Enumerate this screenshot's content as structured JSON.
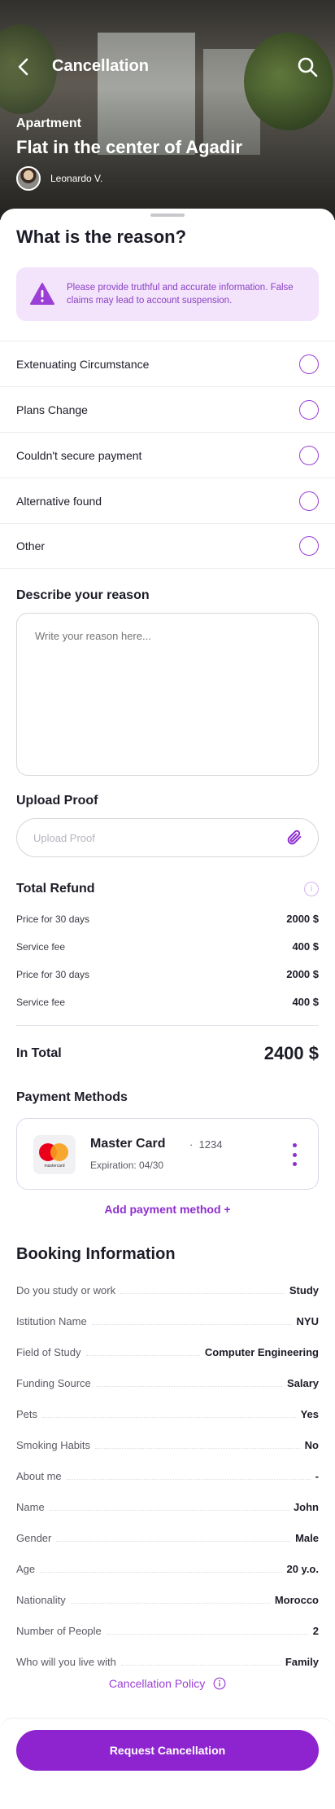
{
  "header": {
    "title": "Cancellation",
    "back_icon": "chevron-left-icon",
    "search_icon": "search-icon"
  },
  "listing": {
    "type": "Apartment",
    "title": "Flat in the center of Agadir",
    "host_name": "Leonardo V."
  },
  "reason": {
    "heading": "What is the reason?",
    "alert_text": "Please provide truthful and accurate information. False claims may lead to account suspension.",
    "options": [
      {
        "label": "Extenuating Circumstance"
      },
      {
        "label": "Plans Change"
      },
      {
        "label": "Couldn't secure payment"
      },
      {
        "label": "Alternative found"
      },
      {
        "label": "Other"
      }
    ]
  },
  "describe": {
    "heading": "Describe your reason",
    "placeholder": "Write your reason here..."
  },
  "upload": {
    "heading": "Upload Proof",
    "placeholder": "Upload Proof"
  },
  "refund": {
    "heading": "Total Refund",
    "rows": [
      {
        "label": "Price for 30 days",
        "value": "2000 $"
      },
      {
        "label": "Service fee",
        "value": "400 $"
      },
      {
        "label": "Price for 30 days",
        "value": "2000 $"
      },
      {
        "label": "Service fee",
        "value": "400 $"
      }
    ],
    "total_label": "In Total",
    "total_value": "2400 $"
  },
  "payment": {
    "heading": "Payment Methods",
    "card": {
      "name": "Master Card",
      "separator": "·",
      "number": "1234",
      "expiration": "Expiration: 04/30",
      "logo_text": "mastercard"
    },
    "add_label": "Add payment method +"
  },
  "booking": {
    "heading": "Booking Information",
    "rows": [
      {
        "label": "Do you study or work",
        "value": "Study"
      },
      {
        "label": "Istitution Name",
        "value": "NYU"
      },
      {
        "label": "Field of Study",
        "value": "Computer Engineering"
      },
      {
        "label": "Funding Source",
        "value": "Salary"
      },
      {
        "label": "Pets",
        "value": "Yes"
      },
      {
        "label": "Smoking Habits",
        "value": "No"
      },
      {
        "label": "About me",
        "value": "-"
      },
      {
        "label": "Name",
        "value": "John"
      },
      {
        "label": "Gender",
        "value": "Male"
      },
      {
        "label": "Age",
        "value": "20 y.o."
      },
      {
        "label": "Nationality",
        "value": "Morocco"
      },
      {
        "label": "Number of People",
        "value": "2"
      },
      {
        "label": "Who will you live with",
        "value": "Family"
      }
    ]
  },
  "policy_link": "Cancellation Policy",
  "cta_label": "Request Cancellation",
  "colors": {
    "accent": "#8e24cf",
    "alert_bg": "#f3e4fc",
    "alert_text": "#8a3fc4"
  }
}
